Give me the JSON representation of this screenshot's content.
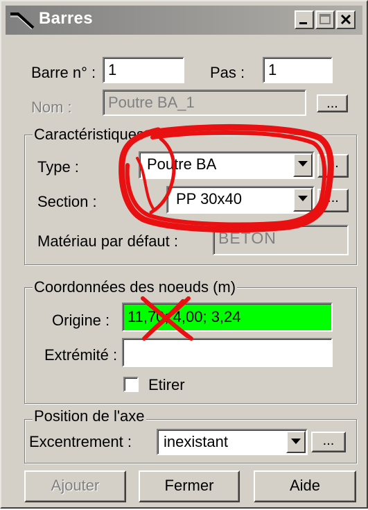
{
  "window": {
    "title": "Barres",
    "controls": {
      "minimize": "minimize-icon",
      "maximize": "maximize-icon",
      "close": "close-icon"
    }
  },
  "barre": {
    "label": "Barre n° :",
    "value": "1"
  },
  "pas": {
    "label": "Pas :",
    "value": "1"
  },
  "nom": {
    "label": "Nom :",
    "value": "Poutre BA_1",
    "browse_label": "..."
  },
  "caracteristiques": {
    "title": "Caractéristiques",
    "type": {
      "label": "Type :",
      "value": "Poutre BA",
      "browse_label": "..."
    },
    "section": {
      "label": "Section :",
      "value": "PP 30x40",
      "browse_label": "..."
    },
    "materiau": {
      "label": "Matériau par défaut :",
      "value": "BETON"
    }
  },
  "coordonnees": {
    "title": "Coordonnées des noeuds (m)",
    "origine": {
      "label": "Origine :",
      "value": "11,70; 4,00; 3,24"
    },
    "extremite": {
      "label": "Extrémité :",
      "value": ""
    },
    "etirer": {
      "label": "Etirer",
      "checked": false
    }
  },
  "position_axe": {
    "title": "Position de l'axe",
    "excentrement": {
      "label": "Excentrement :",
      "value": "inexistant",
      "browse_label": "..."
    }
  },
  "buttons": {
    "ajouter": "Ajouter",
    "fermer": "Fermer",
    "aide": "Aide"
  },
  "colors": {
    "highlight_green": "#00ff00",
    "annotation_red": "#e81010",
    "face": "#d4d0c8"
  }
}
